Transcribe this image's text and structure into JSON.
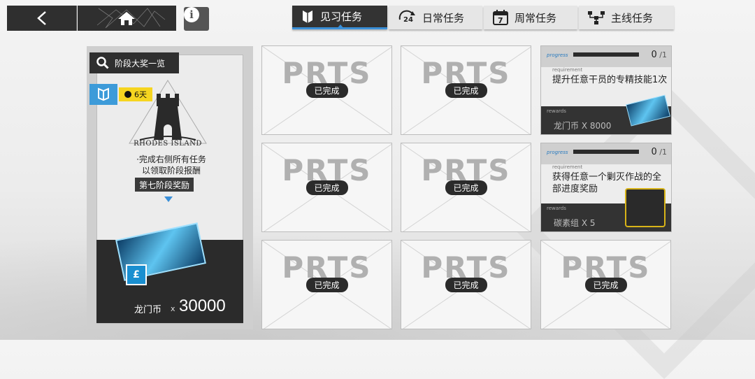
{
  "nav": {
    "back_icon": "chevron-left-icon",
    "home_icon": "home-icon",
    "info_label": "i"
  },
  "tabs": [
    {
      "label": "见习任务",
      "icon": "flag-icon",
      "active": true
    },
    {
      "label": "日常任务",
      "icon": "24-cycle-icon",
      "icon_text": "24",
      "active": false
    },
    {
      "label": "周常任务",
      "icon": "calendar-icon",
      "icon_text": "7",
      "active": false
    },
    {
      "label": "主线任务",
      "icon": "tree-icon",
      "active": false
    }
  ],
  "stage_panel": {
    "overview_label": "阶段大奖一览",
    "timer": "6天",
    "logo_text": "RHODES ISLAND",
    "desc_line1": "·完成右侧所有任务",
    "desc_line2": "以领取阶段报酬",
    "stage_reward_label": "第七阶段奖励",
    "reward_name": "龙门币",
    "reward_x": "x",
    "reward_qty": "30000"
  },
  "completed_badge": "已完成",
  "card_watermark": "PRTS",
  "missions": [
    {
      "progress_label": "progress",
      "count": "0",
      "total": "1",
      "progress_fraction": 0,
      "requirement_label": "requirement",
      "requirement": "提升任意干员的专精技能1次",
      "rewards_label": "rewards",
      "reward": "龙门币 X 8000",
      "reward_icon": "lmd-ticket-icon"
    },
    {
      "progress_label": "progress",
      "count": "0",
      "total": "1",
      "progress_fraction": 0,
      "requirement_label": "requirement",
      "requirement": "获得任意一个剿灭作战的全部进度奖励",
      "rewards_label": "rewards",
      "reward": "碳素组 X 5",
      "reward_icon": "carbon-box-icon"
    }
  ],
  "colors": {
    "accent": "#3a8fd8",
    "timer": "#f6d520",
    "dark": "#2f2f2f"
  }
}
